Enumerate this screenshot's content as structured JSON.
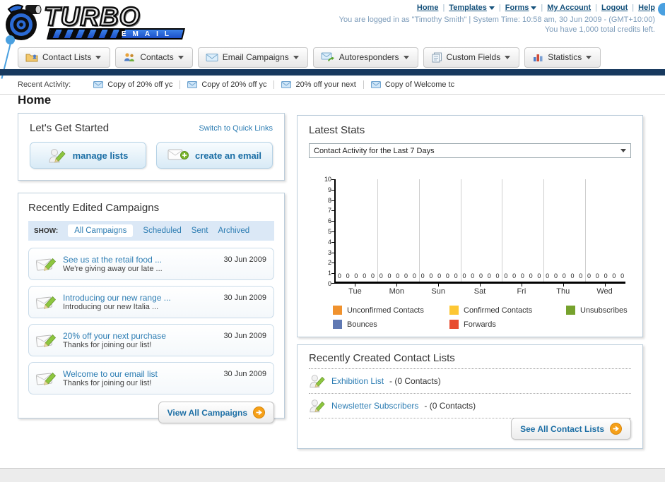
{
  "header": {
    "nav": [
      {
        "label": "Home",
        "dropdown": false
      },
      {
        "label": "Templates",
        "dropdown": true
      },
      {
        "label": "Forms",
        "dropdown": true
      },
      {
        "label": "My Account",
        "dropdown": false
      },
      {
        "label": "Logout",
        "dropdown": false
      },
      {
        "label": "Help",
        "dropdown": false
      }
    ],
    "separator": "|",
    "login_status": "You are logged in as \"Timothy Smith\" | System Time: 10:58 am, 30 Jun 2009 - (GMT+10:00)",
    "credits_note": "You have 1,000 total credits left.",
    "logo_title": "TURBO",
    "logo_subtitle": "EMAIL"
  },
  "main_nav": [
    {
      "label": "Contact Lists"
    },
    {
      "label": "Contacts"
    },
    {
      "label": "Email Campaigns"
    },
    {
      "label": "Autoresponders"
    },
    {
      "label": "Custom Fields"
    },
    {
      "label": "Statistics"
    }
  ],
  "recent_activity": {
    "label": "Recent Activity:",
    "items": [
      {
        "title": "Copy of 20% off yc"
      },
      {
        "title": "Copy of 20% off yc"
      },
      {
        "title": "20% off your next"
      },
      {
        "title": "Copy of Welcome tc"
      }
    ]
  },
  "page_title": "Home",
  "get_started": {
    "title": "Let's Get Started",
    "switch_link": "Switch to Quick Links",
    "manage_lists_label": "manage lists",
    "create_email_label": "create an email"
  },
  "campaigns": {
    "title": "Recently Edited Campaigns",
    "show_label": "SHOW:",
    "tabs": [
      {
        "label": "All Campaigns"
      },
      {
        "label": "Scheduled"
      },
      {
        "label": "Sent"
      },
      {
        "label": "Archived"
      }
    ],
    "items": [
      {
        "title": "See us at the retail food ...",
        "subtitle": "We're giving away our late ...",
        "date": "30 Jun 2009"
      },
      {
        "title": "Introducing our new range ...",
        "subtitle": "Introducing our new Italia ...",
        "date": "30 Jun 2009"
      },
      {
        "title": "20% off your next purchase",
        "subtitle": "Thanks for joining our list!",
        "date": "30 Jun 2009"
      },
      {
        "title": "Welcome to our email list",
        "subtitle": "Thanks for joining our list!",
        "date": "30 Jun 2009"
      }
    ],
    "view_all_label": "View All Campaigns"
  },
  "latest_stats": {
    "title": "Latest Stats",
    "selected_option": "Contact Activity for the Last 7 Days"
  },
  "chart_data": {
    "type": "bar",
    "title": "Contact Activity for the Last 7 Days",
    "categories": [
      "Tue",
      "Mon",
      "Sun",
      "Sat",
      "Fri",
      "Thu",
      "Wed"
    ],
    "series": [
      {
        "name": "Unconfirmed Contacts",
        "color": "#f0922e",
        "values": [
          0,
          0,
          0,
          0,
          0,
          0,
          0
        ]
      },
      {
        "name": "Confirmed Contacts",
        "color": "#fdc734",
        "values": [
          0,
          0,
          0,
          0,
          0,
          0,
          0
        ]
      },
      {
        "name": "Unsubscribes",
        "color": "#76a22d",
        "values": [
          0,
          0,
          0,
          0,
          0,
          0,
          0
        ]
      },
      {
        "name": "Bounces",
        "color": "#6079b3",
        "values": [
          0,
          0,
          0,
          0,
          0,
          0,
          0
        ]
      },
      {
        "name": "Forwards",
        "color": "#e84c2f",
        "values": [
          0,
          0,
          0,
          0,
          0,
          0,
          0
        ]
      }
    ],
    "ylim": [
      0,
      10
    ],
    "yticks": [
      0,
      1,
      2,
      3,
      4,
      5,
      6,
      7,
      8,
      9,
      10
    ],
    "grid": "vertical",
    "legend_position": "bottom"
  },
  "contact_lists": {
    "title": "Recently Created Contact Lists",
    "items": [
      {
        "name": "Exhibition List",
        "suffix": "- (0 Contacts)"
      },
      {
        "name": "Newsletter Subscribers",
        "suffix": "- (0 Contacts)"
      }
    ],
    "see_all_label": "See All Contact Lists"
  }
}
